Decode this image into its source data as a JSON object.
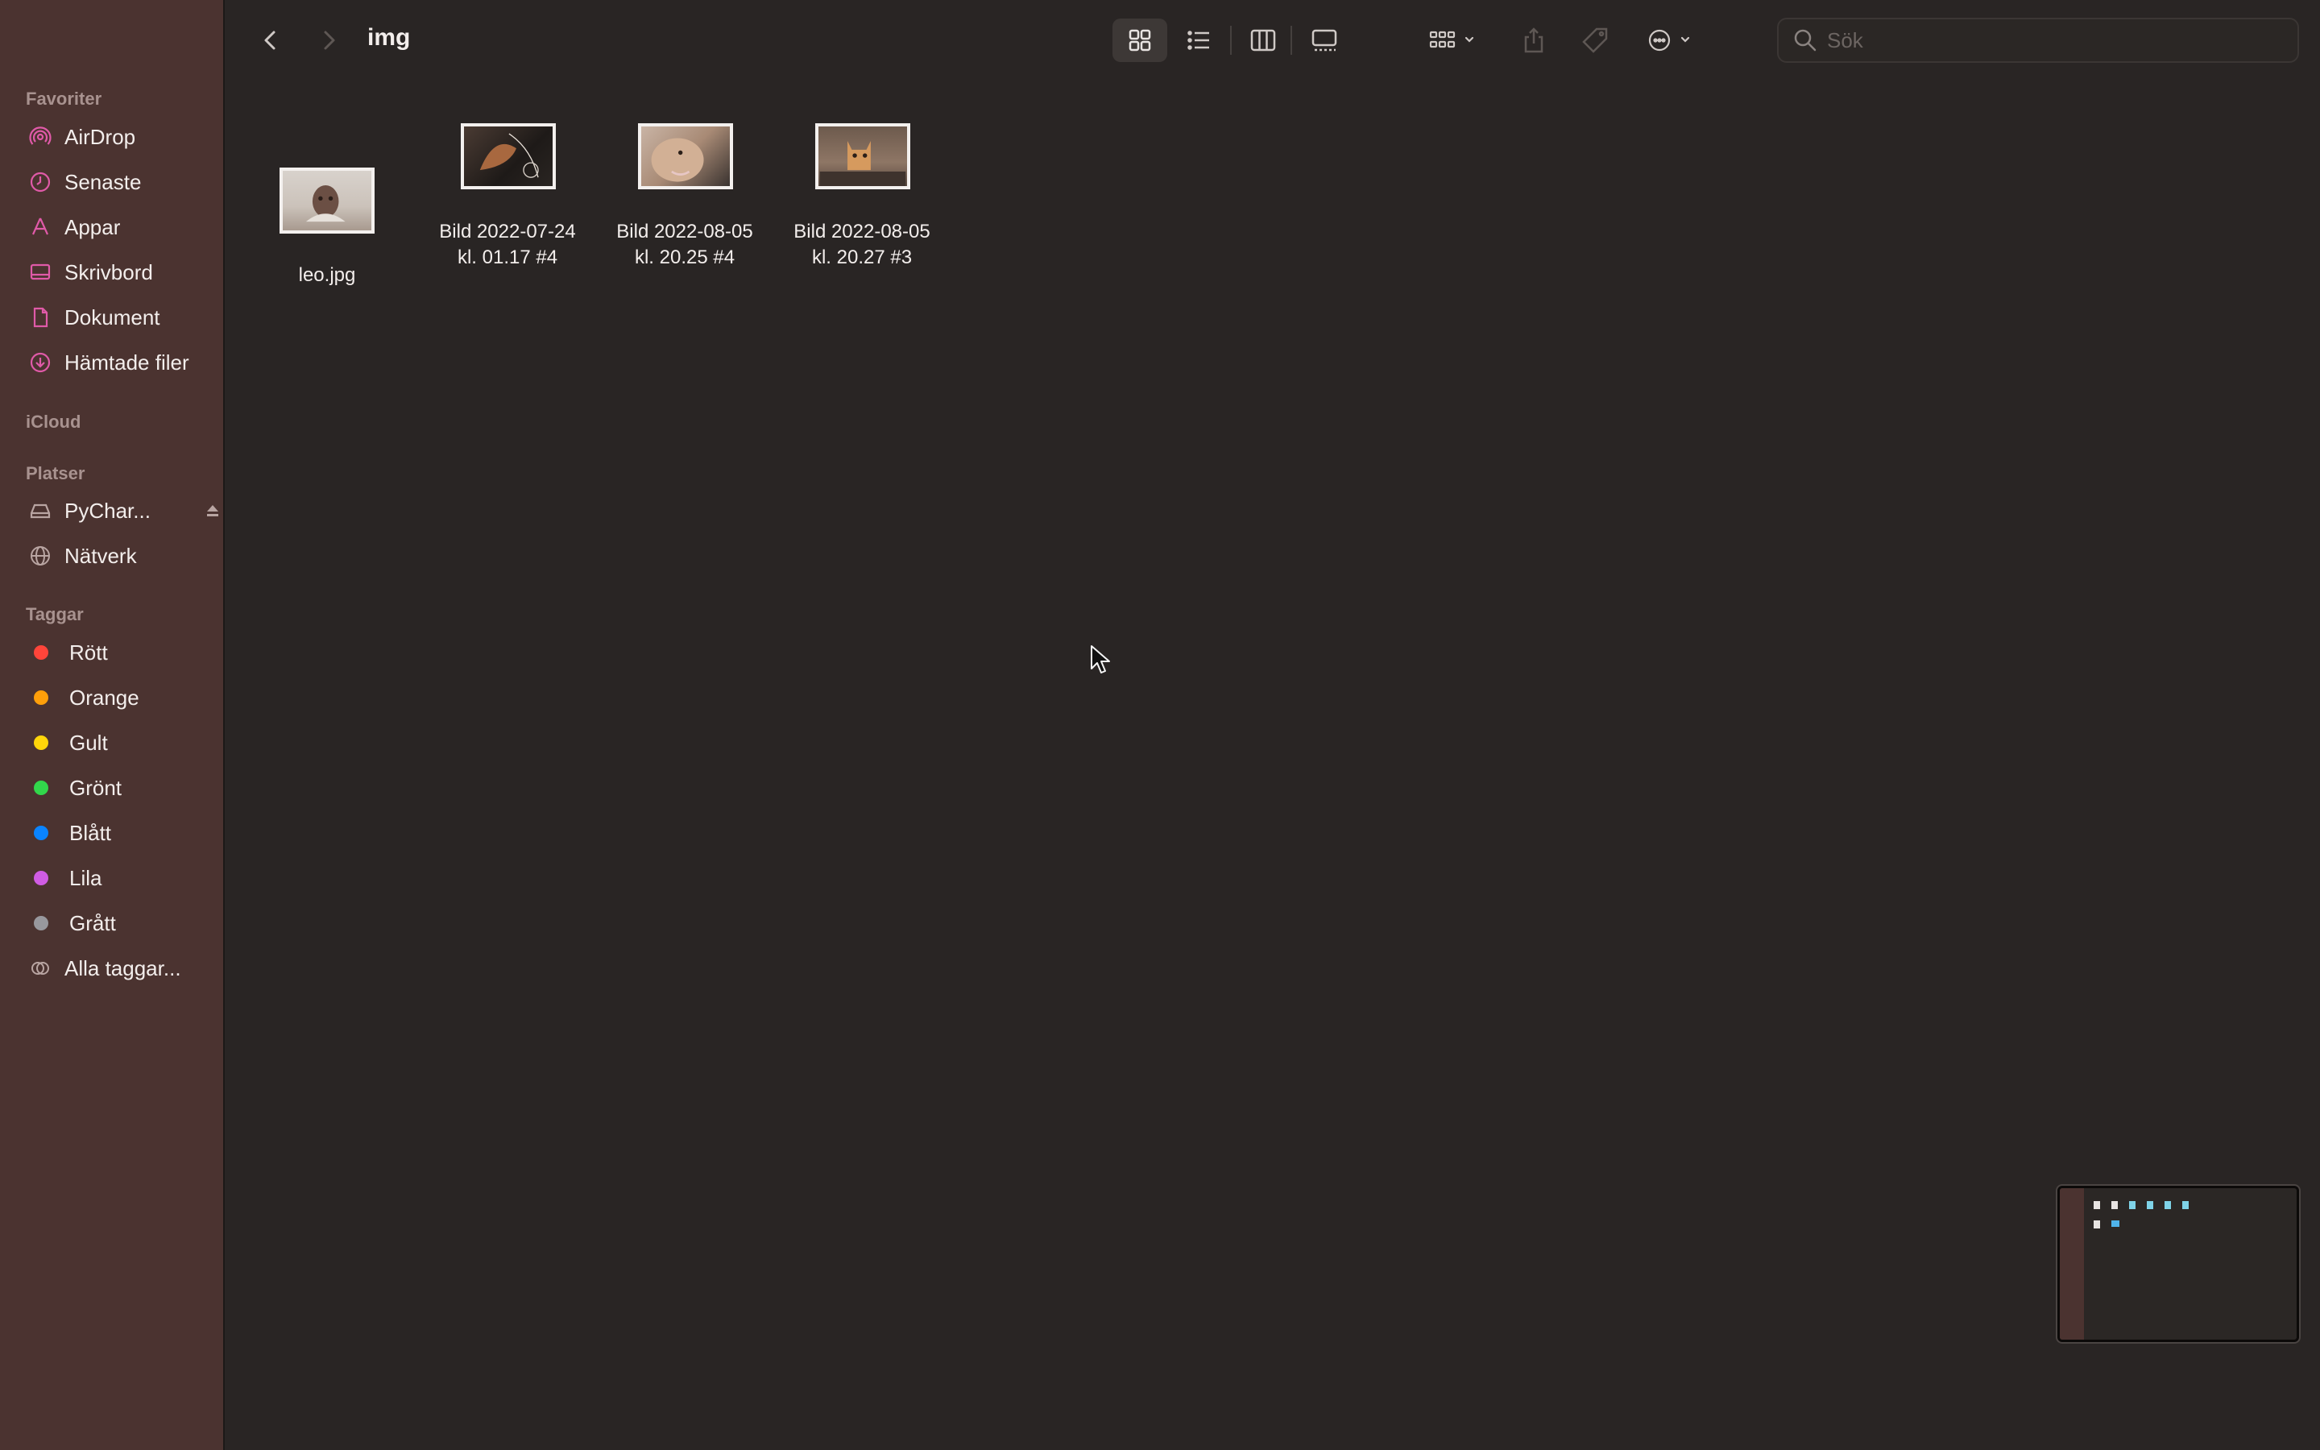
{
  "window": {
    "title": "img"
  },
  "toolbar": {
    "search_placeholder": "Sök",
    "back_icon": "chevron-left-icon",
    "forward_icon": "chevron-right-icon",
    "views": [
      "icon-view",
      "list-view",
      "column-view",
      "gallery-view"
    ],
    "active_view": "icon-view"
  },
  "sidebar": {
    "favorites_header": "Favoriter",
    "favorites": [
      {
        "label": "AirDrop",
        "icon": "airdrop-icon"
      },
      {
        "label": "Senaste",
        "icon": "clock-icon"
      },
      {
        "label": "Appar",
        "icon": "apps-icon"
      },
      {
        "label": "Skrivbord",
        "icon": "desktop-icon"
      },
      {
        "label": "Dokument",
        "icon": "document-icon"
      },
      {
        "label": "Hämtade filer",
        "icon": "download-icon"
      }
    ],
    "icloud_header": "iCloud",
    "places_header": "Platser",
    "places": [
      {
        "label": "PyChar...",
        "icon": "drive-icon"
      },
      {
        "label": "Nätverk",
        "icon": "network-icon"
      }
    ],
    "tags_header": "Taggar",
    "tags": [
      {
        "label": "Rött",
        "color": "#ff453a"
      },
      {
        "label": "Orange",
        "color": "#ff9f0a"
      },
      {
        "label": "Gult",
        "color": "#ffd60a"
      },
      {
        "label": "Grönt",
        "color": "#32d74b"
      },
      {
        "label": "Blått",
        "color": "#0a84ff"
      },
      {
        "label": "Lila",
        "color": "#d05ce3"
      },
      {
        "label": "Grått",
        "color": "#98989d"
      }
    ],
    "all_tags": "Alla taggar..."
  },
  "files": [
    {
      "line1": "leo.jpg",
      "line2": ""
    },
    {
      "line1": "Bild 2022-07-24",
      "line2": "kl. 01.17 #4"
    },
    {
      "line1": "Bild 2022-08-05",
      "line2": "kl. 20.25 #4"
    },
    {
      "line1": "Bild 2022-08-05",
      "line2": "kl. 20.27 #3"
    }
  ]
}
